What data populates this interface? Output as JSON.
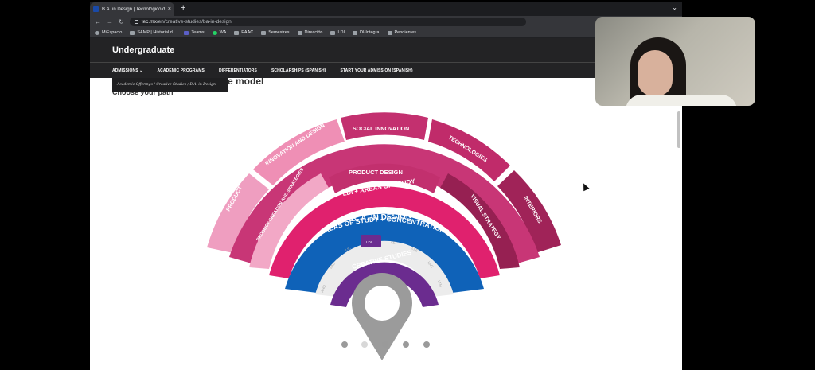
{
  "browser": {
    "tab_title": "B.A. in Design | Tecnológico de",
    "url_host": "tec.mx",
    "url_path": "/en/creative-studies/ba-in-design",
    "bookmarks": [
      "MiEspacio",
      "SAMP | Historial d...",
      "Teams",
      "WA",
      "EAAC",
      "Semestres",
      "Dirección",
      "LDI",
      "DI-Integra",
      "Pendientes"
    ]
  },
  "site": {
    "title": "Undergraduate",
    "nav": [
      "ADMISSIONS",
      "ACADEMIC PROGRAMS",
      "DIFFERENTIATORS",
      "SCHOLARSHIPS (SPANISH)",
      "START YOUR ADMISSION (SPANISH)"
    ],
    "breadcrumb": "Academic Offerings  / Creative Studies  / B.A. in Design"
  },
  "page": {
    "heading_fragment": "e model",
    "subheading": "Choose your path"
  },
  "diagram": {
    "outer_ring": [
      "PRODUCT",
      "INNOVATION AND DESIGN",
      "SOCIAL INNOVATION",
      "TECHNOLOGIES",
      "INTERIORS"
    ],
    "areas_label": "AREAS OF STUDY + CONCENTRATIONS",
    "area_left": "PRODUCT CREATION AND STRATEGIES",
    "product_design": "PRODUCT DESIGN",
    "visual_strategy": "VISUAL STRATEGY",
    "ldi_areas": "LDI + AREAS OF STUDY",
    "degree": "B. A. IN DESIGN",
    "programs": [
      "ARQ",
      "LAD",
      "LIC",
      "LDI",
      "LEI",
      "LLE",
      "LAC",
      "LTM"
    ],
    "selected_program": "LDI",
    "creative_studies": "CREATIVE STUDIES",
    "colors": {
      "outer": "#c5306e",
      "outer_light": "#ef9ec0",
      "areas": "#c83676",
      "ldi": "#e0216e",
      "degree": "#0f62b8",
      "creative": "#6b2c8f",
      "pin": "#9b9b9b"
    }
  },
  "carousel": {
    "pages": 5,
    "active": 3
  }
}
